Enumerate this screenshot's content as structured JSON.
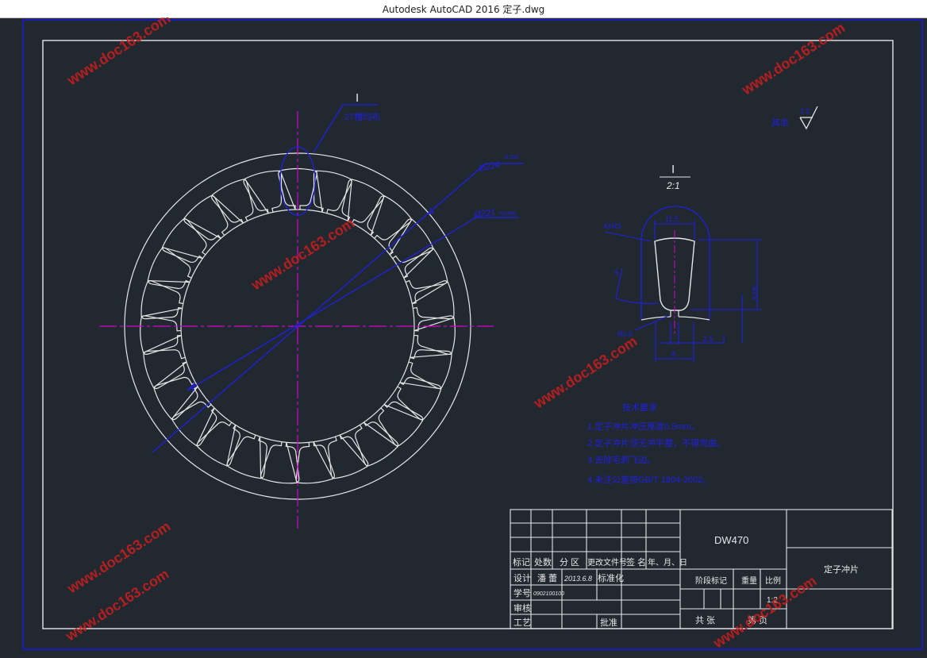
{
  "window": {
    "title": "Autodesk AutoCAD 2016     定子.dwg"
  },
  "colors": {
    "background": "#212830",
    "frame": "#1a1ad8",
    "outline": "#e6e6e6",
    "dimension": "#2020e0",
    "centerline": "#d400d4",
    "watermark": "#c81e1e"
  },
  "drawing": {
    "section_mark": "I",
    "slot_callout": "27槽均布",
    "dia_outer": "Ø224",
    "dia_outer_tol": "-0.032",
    "dia_inner": "Ø221",
    "dia_inner_tol": "+0.046",
    "roughness_label": "其余",
    "roughness_value": "3.2",
    "detail_mark": "I",
    "detail_scale": "2:1",
    "detail_dim_top": "11.5",
    "detail_dim_radius": "4XR3",
    "detail_dim_angle": "3°",
    "detail_dim_height": "30.5",
    "detail_dim_r05": "R0.5",
    "detail_dim_2_5": "2.5",
    "detail_dim_8": "8",
    "notes_title": "技术要求",
    "notes": [
      "1.定子冲片冲压厚度0.5mm。",
      "2.定子冲片须无冲平整，不得弯曲。",
      "3.去除毛刺飞边。",
      "4.未注公差按GB/T 1804-2002。"
    ]
  },
  "title_block": {
    "material": "DW470",
    "part_name": "定子冲片",
    "header_cells": [
      "标记",
      "处数",
      "分 区",
      "更改文件号",
      "签 名",
      "年、月、日"
    ],
    "row_design": [
      "设计",
      "潘 蕾",
      "2013.6.8",
      "标准化"
    ],
    "row_student": [
      "学号",
      "0902100100"
    ],
    "row_review": [
      "审核"
    ],
    "row_process": [
      "工艺",
      "批准"
    ],
    "stage_label": "阶段标记",
    "weight_label": "重量",
    "scale_label": "比例",
    "scale_value": "1:2",
    "total_label": "共 张",
    "sheet_label": "第 页"
  },
  "watermarks": [
    "www.doc163.com",
    "www.doc163.com",
    "www.doc163.com",
    "www.doc163.com",
    "www.doc163.com",
    "www.doc163.com",
    "www.doc163.com"
  ]
}
